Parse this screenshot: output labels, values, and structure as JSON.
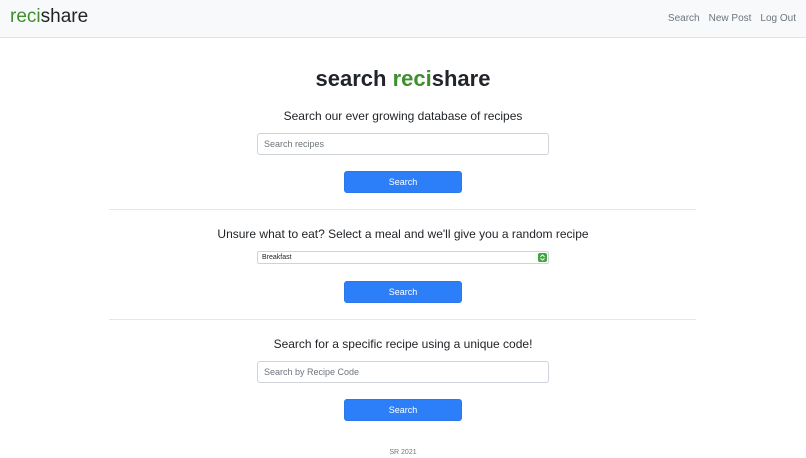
{
  "navbar": {
    "brand_part1": "reci",
    "brand_part2": "share",
    "links": [
      "Search",
      "New Post",
      "Log Out"
    ]
  },
  "page_title": {
    "prefix": "search ",
    "brand_part1": "reci",
    "brand_part2": "share"
  },
  "sections": {
    "search": {
      "heading": "Search our ever growing database of recipes",
      "placeholder": "Search recipes",
      "button": "Search"
    },
    "random": {
      "heading": "Unsure what to eat? Select a meal and we'll give you a random recipe",
      "selected_meal": "Breakfast",
      "button": "Search"
    },
    "code": {
      "heading": "Search for a specific recipe using a unique code!",
      "placeholder": "Search by Recipe Code",
      "button": "Search"
    }
  },
  "footer": "SR 2021",
  "colors": {
    "brand_green": "#3f8f2c",
    "button_blue": "#2d7ff9",
    "navbar_bg": "#f8f9fa"
  }
}
